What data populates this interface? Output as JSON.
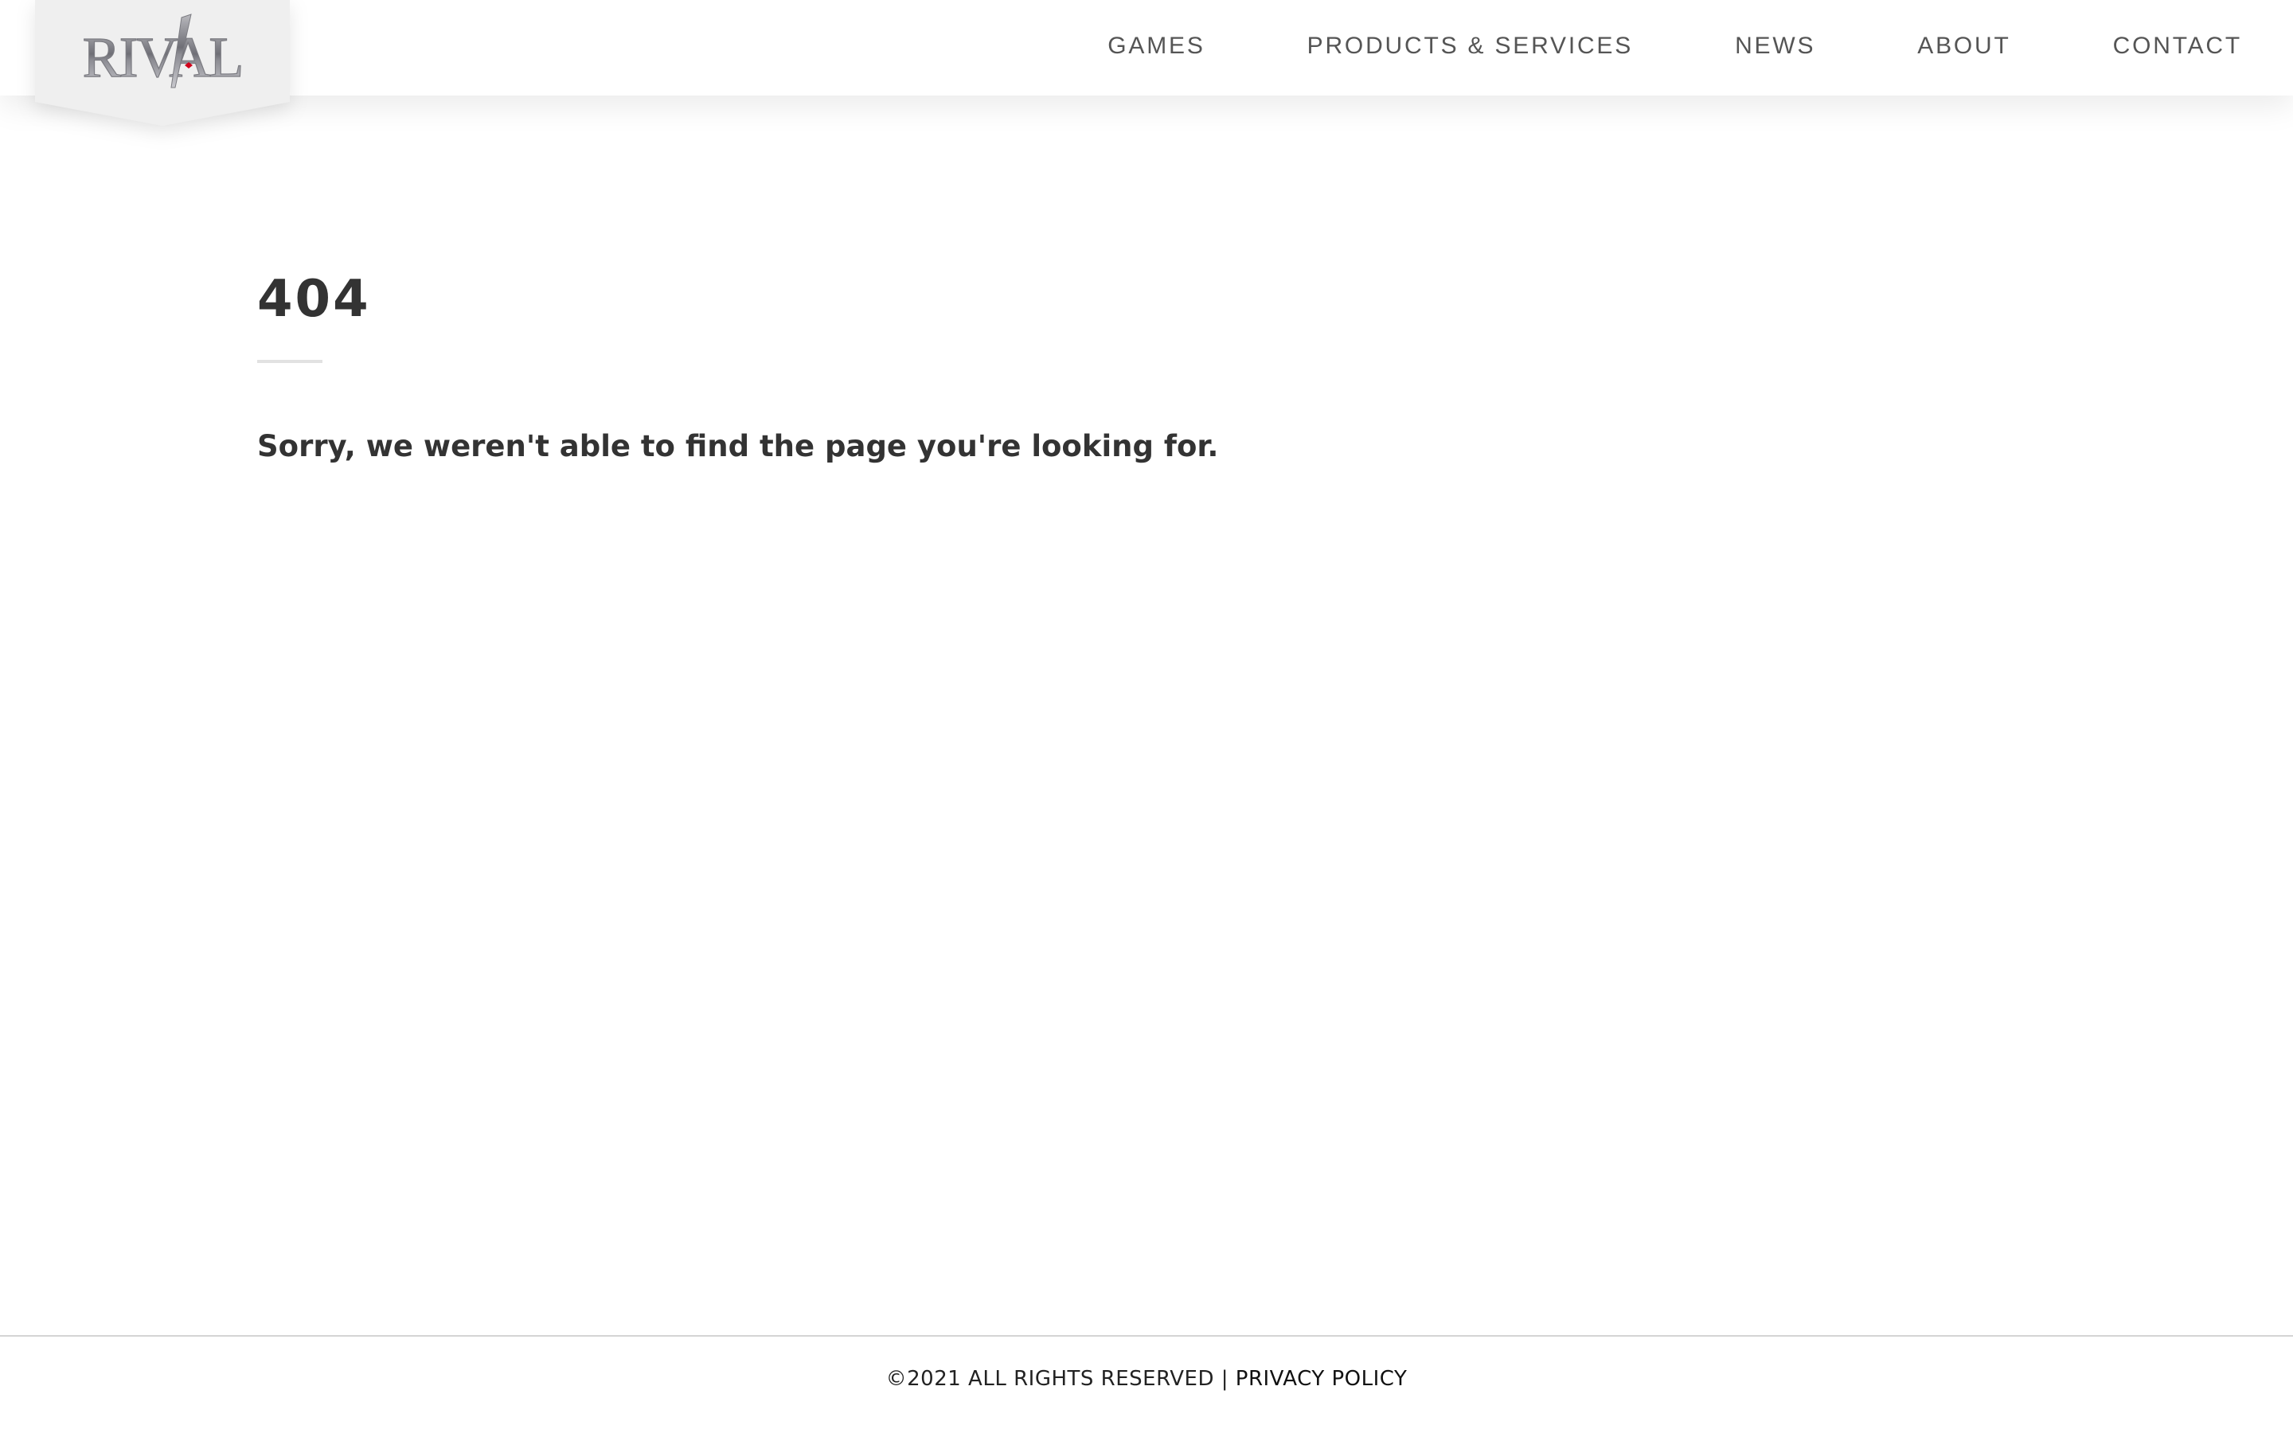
{
  "header": {
    "logo": {
      "text": "RIVAL",
      "accent_color": "#d0021b"
    },
    "nav": [
      {
        "label": "GAMES"
      },
      {
        "label": "PRODUCTS & SERVICES"
      },
      {
        "label": "NEWS"
      },
      {
        "label": "ABOUT"
      },
      {
        "label": "CONTACT"
      }
    ]
  },
  "main": {
    "error_code": "404",
    "message": "Sorry, we weren't able to find the page you're looking for."
  },
  "footer": {
    "copyright": "©2021 ALL RIGHTS RESERVED",
    "separator": "|",
    "privacy_link": "PRIVACY POLICY"
  },
  "colors": {
    "text": "#333333",
    "nav_text": "#555555",
    "divider": "#e2e2e2",
    "footer_border": "#d4d4d4",
    "logo_badge": "#efefef"
  }
}
